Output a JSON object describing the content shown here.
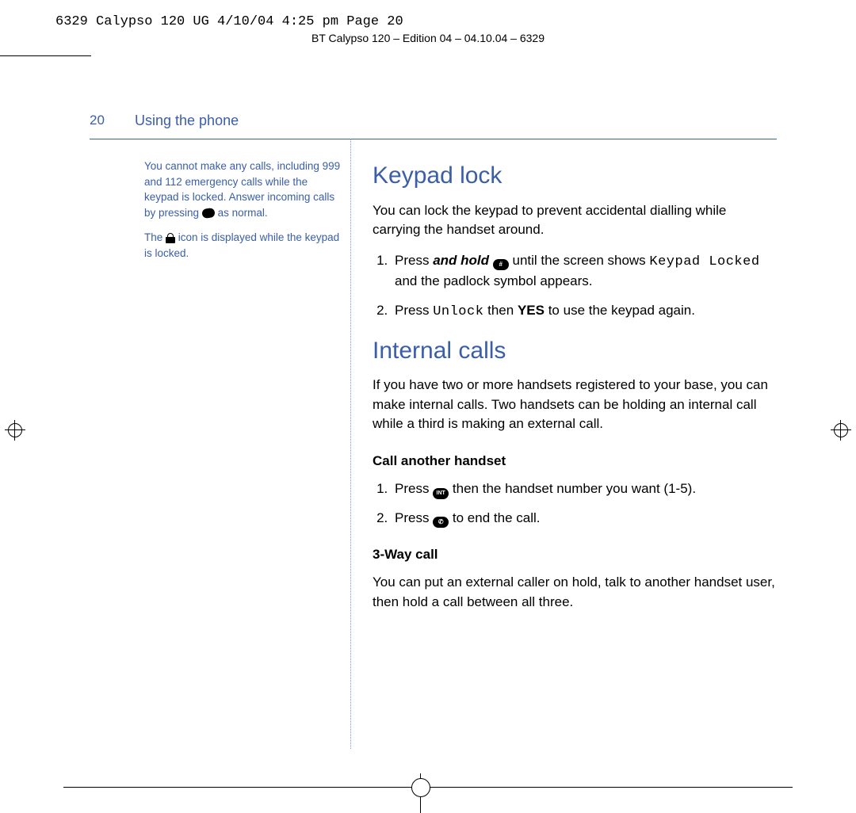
{
  "print_slug": "6329 Calypso 120 UG   4/10/04  4:25 pm  Page 20",
  "running_head": "BT Calypso 120 – Edition 04 – 04.10.04 – 6329",
  "page_number": "20",
  "section_title": "Using the phone",
  "sidebar": {
    "note1_a": "You cannot make any calls, including 999 and 112 emergency calls while the keypad is locked. Answer incoming calls by pressing ",
    "note1_b": " as normal.",
    "note2_a": "The ",
    "note2_b": " icon is displayed while the keypad is locked."
  },
  "main": {
    "h1": "Keypad lock",
    "p1": "You can lock the keypad to prevent accidental dialling while carrying the handset around.",
    "step1_a": "Press ",
    "step1_bi": "and hold",
    "step1_b": " until the screen shows ",
    "step1_lcd": "Keypad Locked",
    "step1_c": " and the padlock symbol appears.",
    "step2_a": "Press ",
    "step2_lcd": "Unlock",
    "step2_b": " then ",
    "step2_bold": "YES",
    "step2_c": " to use the keypad again.",
    "h2": "Internal calls",
    "p2": "If you have two or more handsets registered to your base, you can make internal calls. Two handsets can be holding an internal call while a third is making an external call.",
    "sub1": "Call another handset",
    "sub1_step1_a": "Press ",
    "sub1_step1_b": " then the handset number you want (1-5).",
    "sub1_step2_a": "Press ",
    "sub1_step2_b": " to end the call.",
    "sub2": "3-Way call",
    "p3": "You can put an external caller on hold, talk to another handset user, then hold a call between all three."
  },
  "icons": {
    "phone": "phone-icon",
    "lock": "lock-icon",
    "hash": "#",
    "int": "INT",
    "end": "✆"
  }
}
